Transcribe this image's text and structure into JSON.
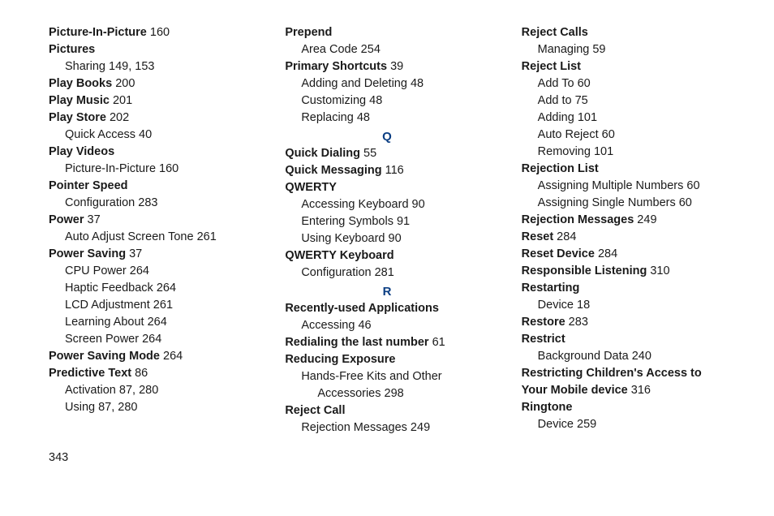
{
  "pageNumber": "343",
  "col1": [
    {
      "type": "line",
      "term": "Picture-In-Picture",
      "pg": " 160"
    },
    {
      "type": "line",
      "term": "Pictures"
    },
    {
      "type": "line",
      "sub": true,
      "term": "Sharing",
      "pg": " 149, 153"
    },
    {
      "type": "line",
      "term": "Play Books",
      "pg": " 200"
    },
    {
      "type": "line",
      "term": "Play Music",
      "pg": " 201"
    },
    {
      "type": "line",
      "term": "Play Store",
      "pg": " 202"
    },
    {
      "type": "line",
      "sub": true,
      "term": "Quick Access",
      "pg": " 40"
    },
    {
      "type": "line",
      "term": "Play Videos"
    },
    {
      "type": "line",
      "sub": true,
      "term": "Picture-In-Picture",
      "pg": " 160"
    },
    {
      "type": "line",
      "term": "Pointer Speed"
    },
    {
      "type": "line",
      "sub": true,
      "term": "Configuration",
      "pg": " 283"
    },
    {
      "type": "line",
      "term": "Power",
      "pg": " 37"
    },
    {
      "type": "line",
      "sub": true,
      "term": "Auto Adjust Screen Tone",
      "pg": " 261"
    },
    {
      "type": "line",
      "term": "Power Saving",
      "pg": " 37"
    },
    {
      "type": "line",
      "sub": true,
      "term": "CPU Power",
      "pg": " 264"
    },
    {
      "type": "line",
      "sub": true,
      "term": "Haptic Feedback",
      "pg": " 264"
    },
    {
      "type": "line",
      "sub": true,
      "term": "LCD Adjustment",
      "pg": " 261"
    },
    {
      "type": "line",
      "sub": true,
      "term": "Learning About",
      "pg": " 264"
    },
    {
      "type": "line",
      "sub": true,
      "term": "Screen Power",
      "pg": " 264"
    },
    {
      "type": "line",
      "term": "Power Saving Mode",
      "pg": " 264"
    },
    {
      "type": "line",
      "term": "Predictive Text",
      "pg": " 86"
    },
    {
      "type": "line",
      "sub": true,
      "term": "Activation",
      "pg": " 87, 280"
    },
    {
      "type": "line",
      "sub": true,
      "term": "Using",
      "pg": " 87, 280"
    }
  ],
  "col2": [
    {
      "type": "line",
      "term": "Prepend"
    },
    {
      "type": "line",
      "sub": true,
      "term": "Area Code",
      "pg": " 254"
    },
    {
      "type": "line",
      "term": "Primary Shortcuts",
      "pg": " 39"
    },
    {
      "type": "line",
      "sub": true,
      "term": "Adding and Deleting",
      "pg": " 48"
    },
    {
      "type": "line",
      "sub": true,
      "term": "Customizing",
      "pg": " 48"
    },
    {
      "type": "line",
      "sub": true,
      "term": "Replacing",
      "pg": " 48"
    },
    {
      "type": "letter",
      "text": "Q"
    },
    {
      "type": "line",
      "term": "Quick Dialing",
      "pg": " 55"
    },
    {
      "type": "line",
      "term": "Quick Messaging",
      "pg": " 116"
    },
    {
      "type": "line",
      "term": "QWERTY"
    },
    {
      "type": "line",
      "sub": true,
      "term": "Accessing Keyboard",
      "pg": " 90"
    },
    {
      "type": "line",
      "sub": true,
      "term": "Entering Symbols",
      "pg": " 91"
    },
    {
      "type": "line",
      "sub": true,
      "term": "Using Keyboard",
      "pg": " 90"
    },
    {
      "type": "line",
      "term": "QWERTY Keyboard"
    },
    {
      "type": "line",
      "sub": true,
      "term": "Configuration",
      "pg": " 281"
    },
    {
      "type": "letter",
      "text": "R"
    },
    {
      "type": "line",
      "term": "Recently-used Applications"
    },
    {
      "type": "line",
      "sub": true,
      "term": "Accessing",
      "pg": " 46"
    },
    {
      "type": "line",
      "term": "Redialing the last number",
      "pg": " 61"
    },
    {
      "type": "line",
      "term": "Reducing Exposure"
    },
    {
      "type": "line",
      "sub": true,
      "term": "Hands-Free Kits and Other"
    },
    {
      "type": "line",
      "sub2": true,
      "term": "Accessories",
      "pg": " 298"
    },
    {
      "type": "line",
      "term": "Reject Call"
    },
    {
      "type": "line",
      "sub": true,
      "term": "Rejection Messages",
      "pg": " 249"
    }
  ],
  "col3": [
    {
      "type": "line",
      "term": "Reject Calls"
    },
    {
      "type": "line",
      "sub": true,
      "term": "Managing",
      "pg": " 59"
    },
    {
      "type": "line",
      "term": "Reject List"
    },
    {
      "type": "line",
      "sub": true,
      "term": "Add To",
      "pg": " 60"
    },
    {
      "type": "line",
      "sub": true,
      "term": "Add to",
      "pg": " 75"
    },
    {
      "type": "line",
      "sub": true,
      "term": "Adding",
      "pg": " 101"
    },
    {
      "type": "line",
      "sub": true,
      "term": "Auto Reject",
      "pg": " 60"
    },
    {
      "type": "line",
      "sub": true,
      "term": "Removing",
      "pg": " 101"
    },
    {
      "type": "line",
      "term": "Rejection List"
    },
    {
      "type": "line",
      "sub": true,
      "term": "Assigning Multiple Numbers",
      "pg": " 60"
    },
    {
      "type": "line",
      "sub": true,
      "term": "Assigning Single Numbers",
      "pg": " 60"
    },
    {
      "type": "line",
      "term": "Rejection Messages",
      "pg": " 249"
    },
    {
      "type": "line",
      "term": "Reset",
      "pg": " 284"
    },
    {
      "type": "line",
      "term": "Reset Device",
      "pg": " 284"
    },
    {
      "type": "line",
      "term": "Responsible Listening",
      "pg": " 310"
    },
    {
      "type": "line",
      "term": "Restarting"
    },
    {
      "type": "line",
      "sub": true,
      "term": "Device",
      "pg": " 18"
    },
    {
      "type": "line",
      "term": "Restore",
      "pg": " 283"
    },
    {
      "type": "line",
      "term": "Restrict"
    },
    {
      "type": "line",
      "sub": true,
      "term": "Background Data",
      "pg": " 240"
    },
    {
      "type": "line",
      "term": "Restricting Children's Access to Your Mobile device",
      "pg": " 316"
    },
    {
      "type": "line",
      "term": "Ringtone"
    },
    {
      "type": "line",
      "sub": true,
      "term": "Device",
      "pg": " 259"
    }
  ]
}
